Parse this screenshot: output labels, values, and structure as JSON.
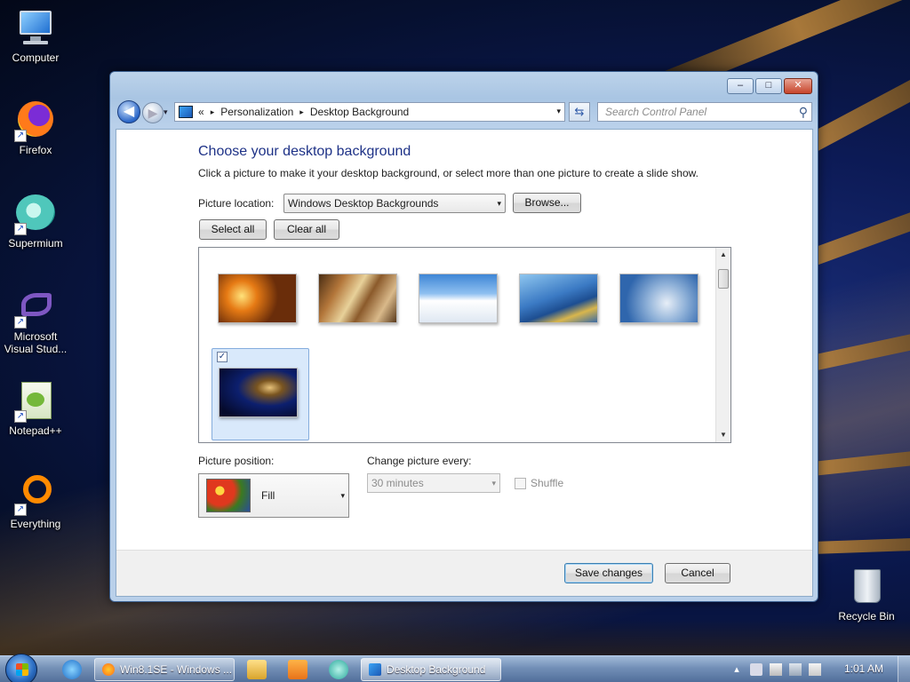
{
  "desktop": {
    "icons": [
      {
        "label": "Computer",
        "icon": "computer-icon"
      },
      {
        "label": "Firefox",
        "icon": "firefox-icon"
      },
      {
        "label": "Supermium",
        "icon": "supermium-icon"
      },
      {
        "label": "Microsoft Visual Stud...",
        "icon": "visual-studio-icon"
      },
      {
        "label": "Notepad++",
        "icon": "notepadpp-icon"
      },
      {
        "label": "Everything",
        "icon": "everything-icon"
      },
      {
        "label": "Recycle Bin",
        "icon": "recycle-bin-icon"
      }
    ]
  },
  "window": {
    "controls": {
      "minimize": "–",
      "maximize": "□",
      "close": "✕"
    },
    "nav": {
      "back": "◀",
      "forward": "▶",
      "dropdown": "▾"
    },
    "address": {
      "prefix": "«",
      "crumb1": "Personalization",
      "crumb2": "Desktop Background",
      "separator": "▸",
      "dropdown": "▾"
    },
    "refresh": "⇆",
    "search": {
      "placeholder": "Search Control Panel",
      "icon": "⚲"
    },
    "title": "Choose your desktop background",
    "subtitle": "Click a picture to make it your desktop background, or select more than one picture to create a slide show.",
    "picture_location": {
      "label": "Picture location:",
      "value": "Windows Desktop Backgrounds",
      "arrow": "▾"
    },
    "browse": "Browse...",
    "select_all": "Select all",
    "clear_all": "Clear all",
    "gallery": {
      "checked_mark": "✓",
      "scroll_up": "▲",
      "scroll_down": "▼"
    },
    "picture_position": {
      "label": "Picture position:",
      "value": "Fill",
      "arrow": "▾"
    },
    "change_every": {
      "label": "Change picture every:",
      "value": "30 minutes",
      "arrow": "▾"
    },
    "shuffle": "Shuffle",
    "save": "Save changes",
    "cancel": "Cancel"
  },
  "taskbar": {
    "tasks": [
      {
        "label": "Win8.1SE - Windows ..."
      },
      {
        "label": "Desktop Background"
      }
    ],
    "tray": {
      "show_hidden": "▴",
      "clock": "1:01 AM"
    }
  },
  "colors": {
    "accent": "#1e3287",
    "taskbar": "#5873a0"
  }
}
